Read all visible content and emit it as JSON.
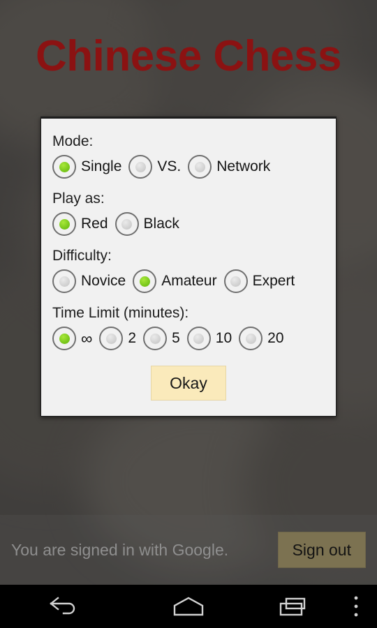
{
  "app": {
    "title": "Chinese Chess"
  },
  "dialog": {
    "groups": [
      {
        "label": "Mode:",
        "options": [
          {
            "label": "Single",
            "selected": true
          },
          {
            "label": "VS.",
            "selected": false
          },
          {
            "label": "Network",
            "selected": false
          }
        ]
      },
      {
        "label": "Play as:",
        "options": [
          {
            "label": "Red",
            "selected": true
          },
          {
            "label": "Black",
            "selected": false
          }
        ]
      },
      {
        "label": "Difficulty:",
        "options": [
          {
            "label": "Novice",
            "selected": false
          },
          {
            "label": "Amateur",
            "selected": true
          },
          {
            "label": "Expert",
            "selected": false
          }
        ]
      },
      {
        "label": "Time Limit (minutes):",
        "options": [
          {
            "label": "∞",
            "selected": true
          },
          {
            "label": "2",
            "selected": false
          },
          {
            "label": "5",
            "selected": false
          },
          {
            "label": "10",
            "selected": false
          },
          {
            "label": "20",
            "selected": false
          }
        ]
      }
    ],
    "okay_label": "Okay"
  },
  "signin": {
    "status_text": "You are signed in with Google.",
    "signout_label": "Sign out"
  },
  "navbar": {
    "back": "back-icon",
    "home": "home-icon",
    "recents": "recents-icon",
    "menu": "overflow-menu-icon"
  },
  "colors": {
    "title": "#8b1212",
    "radio_selected": "#7ac81c",
    "okay_bg": "#faeabb",
    "dialog_bg": "#f1f1f1",
    "signout_bg": "#7c7251"
  }
}
